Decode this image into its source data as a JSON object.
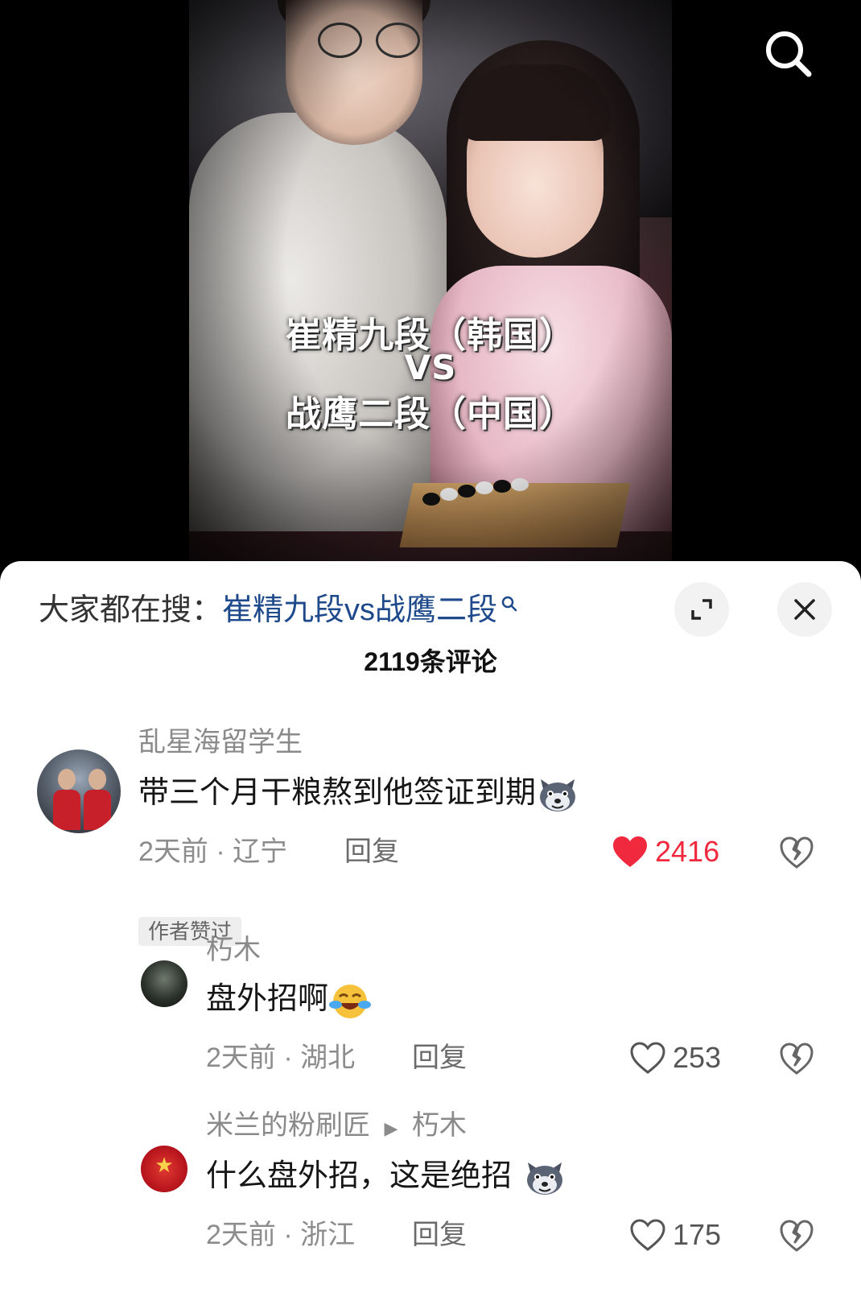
{
  "video": {
    "overlay_line1": "崔精九段（韩国）",
    "overlay_line2": "VS",
    "overlay_line3": "战鹰二段（中国）"
  },
  "search_icon": "search-icon",
  "sheet": {
    "trending_prefix": "大家都在搜：",
    "trending_query": "崔精九段vs战鹰二段",
    "expand_icon": "expand-icon",
    "close_icon": "close-icon",
    "comment_count": "2119条评论"
  },
  "comments": [
    {
      "author": "乱星海留学生",
      "text": "带三个月干粮熬到他签证到期",
      "emoji": "wolf-emoji",
      "time": "2天前",
      "location": "辽宁",
      "reply_label": "回复",
      "likes": "2416",
      "liked": true,
      "badge": "作者赞过"
    },
    {
      "author": "朽木",
      "text": "盘外招啊",
      "emoji": "crying-laughing-emoji",
      "time": "2天前",
      "location": "湖北",
      "reply_label": "回复",
      "likes": "253",
      "liked": false
    },
    {
      "author": "米兰的粉刷匠",
      "reply_to": "朽木",
      "text": "什么盘外招，这是绝招",
      "emoji": "wolf-emoji",
      "time": "2天前",
      "location": "浙江",
      "reply_label": "回复",
      "likes": "175",
      "liked": false
    }
  ],
  "colors": {
    "like_red": "#f0293e",
    "link_blue": "#1e4a8c",
    "meta_gray": "#8c8c8c"
  }
}
